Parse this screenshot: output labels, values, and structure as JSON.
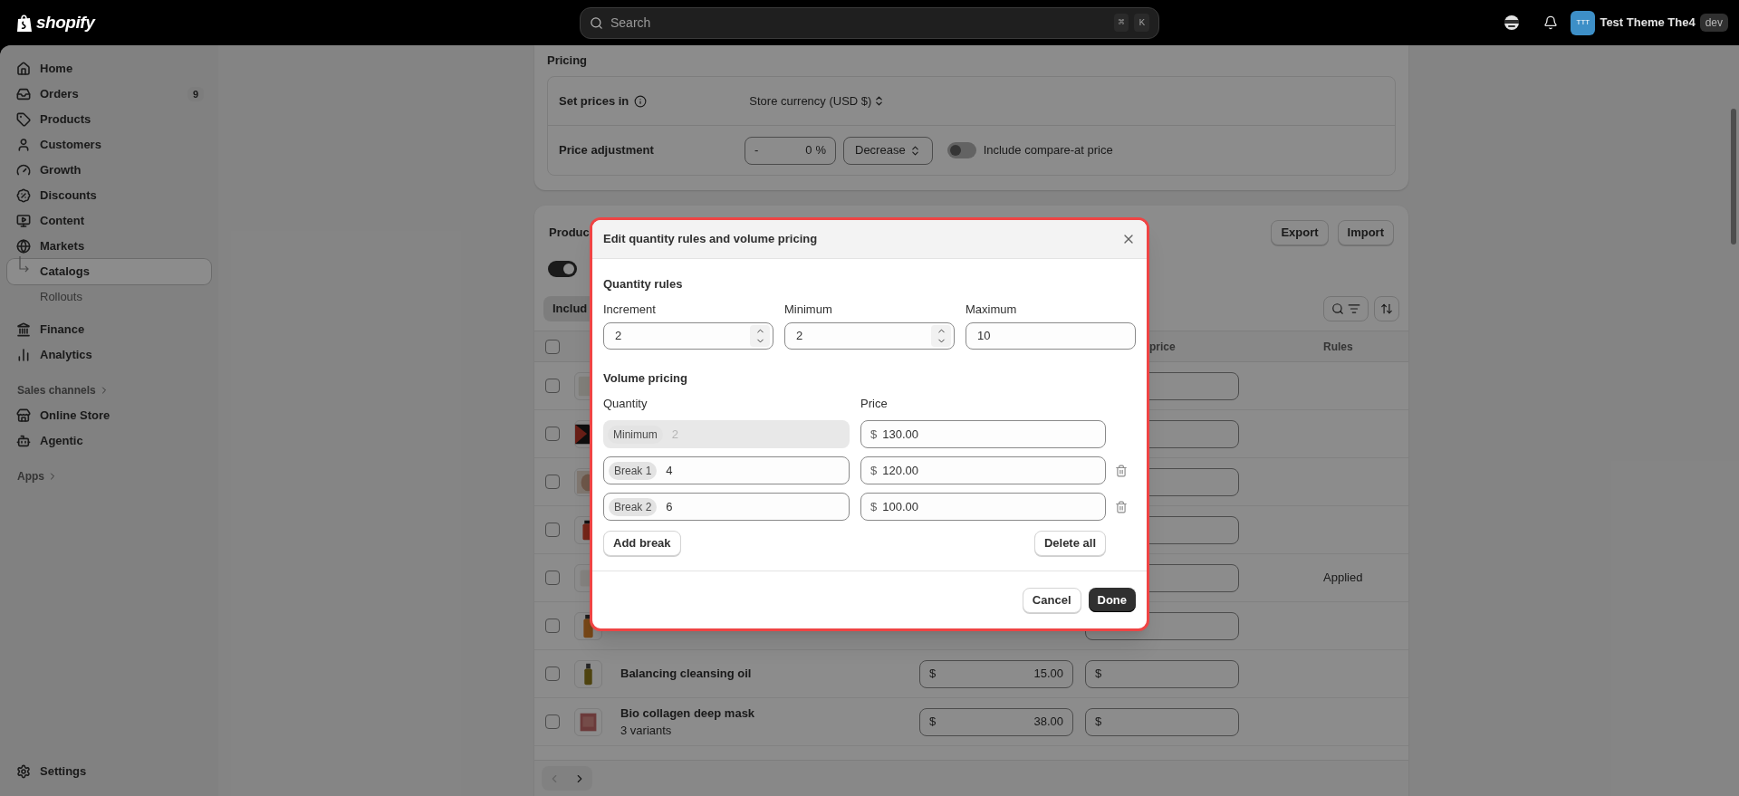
{
  "topbar": {
    "logo": "shopify",
    "search": {
      "placeholder": "Search",
      "shortcut": [
        "⌘",
        "K"
      ]
    },
    "store": {
      "initials": "TTT",
      "name": "Test Theme The4",
      "badge": "dev"
    }
  },
  "sidebar": {
    "sections": [
      {
        "items": [
          {
            "label": "Home",
            "selected": false
          },
          {
            "label": "Orders",
            "badge": "9",
            "selected": false
          },
          {
            "label": "Products",
            "selected": false
          },
          {
            "label": "Customers",
            "selected": false
          },
          {
            "label": "Growth",
            "selected": false
          },
          {
            "label": "Discounts",
            "selected": false
          },
          {
            "label": "Content",
            "selected": false
          },
          {
            "label": "Markets",
            "selected": false,
            "children": [
              {
                "label": "Catalogs",
                "selected": true
              },
              {
                "label": "Rollouts",
                "selected": false
              }
            ]
          }
        ]
      },
      {
        "items": [
          {
            "label": "Finance",
            "selected": false
          },
          {
            "label": "Analytics",
            "selected": false
          }
        ]
      },
      {
        "heading": "Sales channels",
        "items": [
          {
            "label": "Online Store",
            "selected": false
          },
          {
            "label": "Agentic",
            "selected": false
          }
        ]
      },
      {
        "heading": "Apps"
      }
    ],
    "footer": {
      "label": "Settings",
      "selected": false
    }
  },
  "pricing": {
    "title": "Pricing",
    "set_prices": {
      "label": "Set prices in",
      "value": "Store currency (USD $)"
    },
    "adjustment": {
      "label": "Price adjustment",
      "sign": "-",
      "amount": "0",
      "unit": "%",
      "direction": "Decrease",
      "compare_toggle": {
        "label": "Include compare-at price",
        "on": false
      }
    }
  },
  "products": {
    "title": "Produc",
    "toggle": {
      "on": true
    },
    "tab": "Includ",
    "buttons": [
      "Export",
      "Import"
    ],
    "columns": [
      {
        "label": "price"
      },
      {
        "label": "Rules"
      }
    ],
    "header_checked": false,
    "rows": [
      {
        "checked": false
      },
      {
        "checked": false
      },
      {
        "checked": false
      },
      {
        "checked": false
      },
      {
        "checked": false,
        "rules": "Applied"
      },
      {
        "checked": false
      },
      {
        "checked": false,
        "title": "Balancing cleansing oil",
        "price": {
          "currency": "$",
          "value": "15.00"
        },
        "compare_at": {
          "currency": "$"
        }
      },
      {
        "checked": false,
        "title": "Bio collagen deep mask",
        "subtitle": "3 variants",
        "price": {
          "currency": "$",
          "value": "38.00"
        },
        "compare_at": {
          "currency": "$"
        }
      }
    ],
    "pagination": {
      "previous_disabled": true,
      "next_disabled": false
    }
  },
  "modal": {
    "title": "Edit quantity rules and volume pricing",
    "quantity_rules": {
      "title": "Quantity rules",
      "fields": [
        {
          "label": "Increment",
          "value": "2",
          "kind": "stepper"
        },
        {
          "label": "Minimum",
          "value": "2",
          "kind": "stepper"
        },
        {
          "label": "Maximum",
          "value": "10",
          "kind": "plain"
        }
      ]
    },
    "volume_pricing": {
      "title": "Volume pricing",
      "columns": [
        "Quantity",
        "Price"
      ],
      "tiers": [
        {
          "tag": "Minimum",
          "quantity": "2",
          "disabled": true,
          "currency": "$",
          "price": "130.00",
          "deletable": false
        },
        {
          "tag": "Break 1",
          "quantity": "4",
          "disabled": false,
          "currency": "$",
          "price": "120.00",
          "deletable": true
        },
        {
          "tag": "Break 2",
          "quantity": "6",
          "disabled": false,
          "currency": "$",
          "price": "100.00",
          "deletable": true
        }
      ]
    },
    "add_button": "Add break",
    "delete_all": "Delete all",
    "buttons": [
      {
        "label": "Cancel",
        "kind": "secondary"
      },
      {
        "label": "Done",
        "kind": "primary"
      }
    ]
  }
}
